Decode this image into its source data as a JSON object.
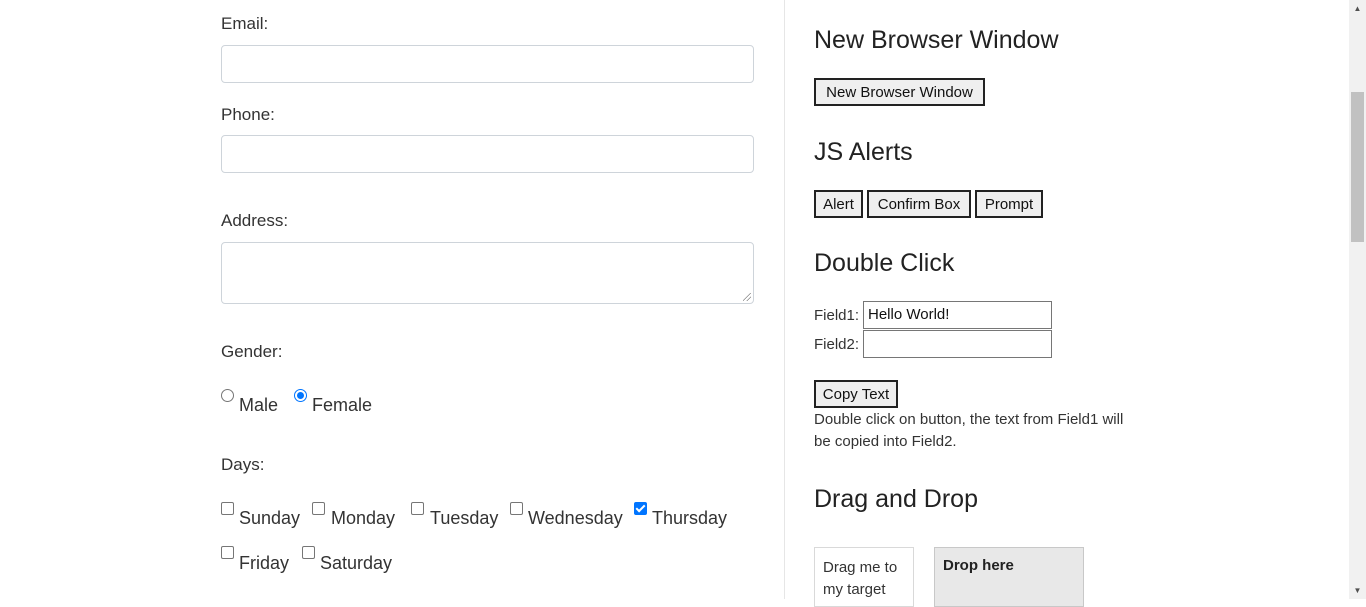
{
  "form": {
    "email_label": "Email:",
    "email_value": "",
    "phone_label": "Phone:",
    "phone_value": "",
    "address_label": "Address:",
    "address_value": "",
    "gender_label": "Gender:",
    "gender_options": [
      {
        "label": "Male",
        "checked": false
      },
      {
        "label": "Female",
        "checked": true
      }
    ],
    "days_label": "Days:",
    "days": [
      {
        "label": "Sunday",
        "checked": false
      },
      {
        "label": "Monday",
        "checked": false
      },
      {
        "label": "Tuesday",
        "checked": false
      },
      {
        "label": "Wednesday",
        "checked": false
      },
      {
        "label": "Thursday",
        "checked": true
      },
      {
        "label": "Friday",
        "checked": false
      },
      {
        "label": "Saturday",
        "checked": false
      }
    ]
  },
  "sidebar": {
    "new_window_heading": "New Browser Window",
    "new_window_button": "New Browser Window",
    "js_alerts_heading": "JS Alerts",
    "alert_button": "Alert",
    "confirm_button": "Confirm Box",
    "prompt_button": "Prompt",
    "double_click_heading": "Double Click",
    "field1_label": "Field1:",
    "field1_value": "Hello World!",
    "field2_label": "Field2:",
    "field2_value": "",
    "copy_button": "Copy Text",
    "copy_note": "Double click on button, the text from Field1 will be copied into Field2.",
    "drag_heading": "Drag and Drop",
    "draggable_text": "Drag me to my target",
    "droppable_text": "Drop here"
  },
  "colors": {
    "accent": "#0075ff",
    "drop_bg": "#e8e8e8"
  }
}
